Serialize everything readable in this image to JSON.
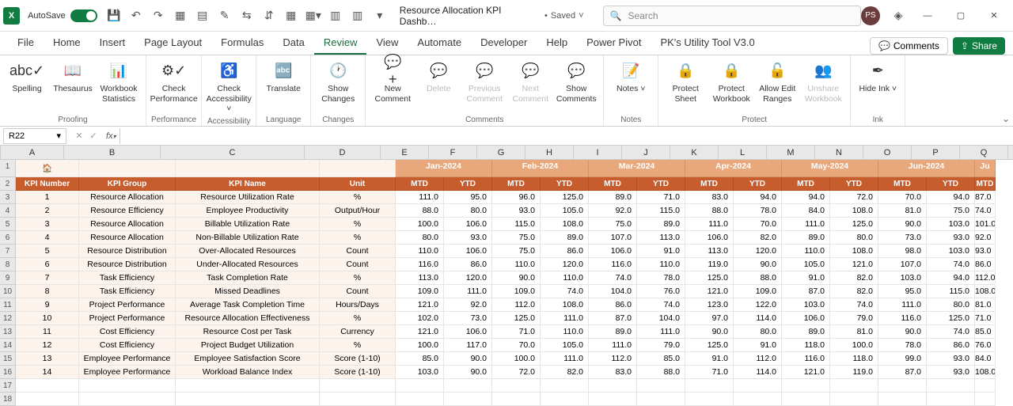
{
  "titlebar": {
    "autosave_label": "AutoSave",
    "doc_name": "Resource Allocation KPI Dashb…",
    "saved_label": "Saved",
    "search_placeholder": "Search",
    "avatar": "PS"
  },
  "menu": {
    "tabs": [
      "File",
      "Home",
      "Insert",
      "Page Layout",
      "Formulas",
      "Data",
      "Review",
      "View",
      "Automate",
      "Developer",
      "Help",
      "Power Pivot",
      "PK's Utility Tool V3.0"
    ],
    "active": "Review",
    "comments": "Comments",
    "share": "Share"
  },
  "ribbon": {
    "groups": [
      {
        "label": "Proofing",
        "items": [
          {
            "name": "spelling",
            "label": "Spelling",
            "icon": "abc✓"
          },
          {
            "name": "thesaurus",
            "label": "Thesaurus",
            "icon": "📖"
          },
          {
            "name": "workbook-stats",
            "label": "Workbook Statistics",
            "icon": "📊"
          }
        ]
      },
      {
        "label": "Performance",
        "items": [
          {
            "name": "check-performance",
            "label": "Check Performance",
            "icon": "⚙✓"
          }
        ]
      },
      {
        "label": "Accessibility",
        "items": [
          {
            "name": "check-accessibility",
            "label": "Check Accessibility ˅",
            "icon": "♿"
          }
        ]
      },
      {
        "label": "Language",
        "items": [
          {
            "name": "translate",
            "label": "Translate",
            "icon": "🔤"
          }
        ]
      },
      {
        "label": "Changes",
        "items": [
          {
            "name": "show-changes",
            "label": "Show Changes",
            "icon": "🕐"
          }
        ]
      },
      {
        "label": "Comments",
        "items": [
          {
            "name": "new-comment",
            "label": "New Comment",
            "icon": "💬+"
          },
          {
            "name": "delete-comment",
            "label": "Delete",
            "icon": "💬",
            "disabled": true
          },
          {
            "name": "prev-comment",
            "label": "Previous Comment",
            "icon": "💬",
            "disabled": true
          },
          {
            "name": "next-comment",
            "label": "Next Comment",
            "icon": "💬",
            "disabled": true
          },
          {
            "name": "show-comments",
            "label": "Show Comments",
            "icon": "💬"
          }
        ]
      },
      {
        "label": "Notes",
        "items": [
          {
            "name": "notes",
            "label": "Notes ˅",
            "icon": "📝"
          }
        ]
      },
      {
        "label": "Protect",
        "items": [
          {
            "name": "protect-sheet",
            "label": "Protect Sheet",
            "icon": "🔒"
          },
          {
            "name": "protect-workbook",
            "label": "Protect Workbook",
            "icon": "🔒"
          },
          {
            "name": "allow-edit-ranges",
            "label": "Allow Edit Ranges",
            "icon": "🔓"
          },
          {
            "name": "unshare-workbook",
            "label": "Unshare Workbook",
            "icon": "👥",
            "disabled": true
          }
        ]
      },
      {
        "label": "Ink",
        "items": [
          {
            "name": "hide-ink",
            "label": "Hide Ink ˅",
            "icon": "✒"
          }
        ]
      }
    ]
  },
  "formulabar": {
    "cell_ref": "R22"
  },
  "columns_letters": [
    "A",
    "B",
    "C",
    "D",
    "E",
    "F",
    "G",
    "H",
    "I",
    "J",
    "K",
    "L",
    "M",
    "N",
    "O",
    "P",
    "Q"
  ],
  "months": [
    "Jan-2024",
    "Feb-2024",
    "Mar-2024",
    "Apr-2024",
    "May-2024",
    "Jun-2024",
    "Ju"
  ],
  "header2_left": [
    "KPI Number",
    "KPI Group",
    "KPI Name",
    "Unit"
  ],
  "mtd": "MTD",
  "ytd": "YTD",
  "rows": [
    {
      "n": "1",
      "g": "Resource Allocation",
      "name": "Resource Utilization Rate",
      "unit": "%",
      "v": [
        "111.0",
        "95.0",
        "96.0",
        "125.0",
        "89.0",
        "71.0",
        "83.0",
        "94.0",
        "94.0",
        "72.0",
        "70.0",
        "94.0",
        "87.0"
      ]
    },
    {
      "n": "2",
      "g": "Resource Efficiency",
      "name": "Employee Productivity",
      "unit": "Output/Hour",
      "v": [
        "88.0",
        "80.0",
        "93.0",
        "105.0",
        "92.0",
        "115.0",
        "88.0",
        "78.0",
        "84.0",
        "108.0",
        "81.0",
        "75.0",
        "74.0"
      ]
    },
    {
      "n": "3",
      "g": "Resource Allocation",
      "name": "Billable Utilization Rate",
      "unit": "%",
      "v": [
        "100.0",
        "106.0",
        "115.0",
        "108.0",
        "75.0",
        "89.0",
        "111.0",
        "70.0",
        "111.0",
        "125.0",
        "90.0",
        "103.0",
        "101.0"
      ]
    },
    {
      "n": "4",
      "g": "Resource Allocation",
      "name": "Non-Billable Utilization Rate",
      "unit": "%",
      "v": [
        "80.0",
        "93.0",
        "75.0",
        "89.0",
        "107.0",
        "113.0",
        "106.0",
        "82.0",
        "89.0",
        "80.0",
        "73.0",
        "93.0",
        "92.0"
      ]
    },
    {
      "n": "5",
      "g": "Resource Distribution",
      "name": "Over-Allocated Resources",
      "unit": "Count",
      "v": [
        "110.0",
        "106.0",
        "75.0",
        "86.0",
        "106.0",
        "91.0",
        "113.0",
        "120.0",
        "110.0",
        "108.0",
        "98.0",
        "103.0",
        "93.0"
      ]
    },
    {
      "n": "6",
      "g": "Resource Distribution",
      "name": "Under-Allocated Resources",
      "unit": "Count",
      "v": [
        "116.0",
        "86.0",
        "110.0",
        "120.0",
        "116.0",
        "110.0",
        "119.0",
        "90.0",
        "105.0",
        "121.0",
        "107.0",
        "74.0",
        "86.0"
      ]
    },
    {
      "n": "7",
      "g": "Task Efficiency",
      "name": "Task Completion Rate",
      "unit": "%",
      "v": [
        "113.0",
        "120.0",
        "90.0",
        "110.0",
        "74.0",
        "78.0",
        "125.0",
        "88.0",
        "91.0",
        "82.0",
        "103.0",
        "94.0",
        "112.0"
      ]
    },
    {
      "n": "8",
      "g": "Task Efficiency",
      "name": "Missed Deadlines",
      "unit": "Count",
      "v": [
        "109.0",
        "111.0",
        "109.0",
        "74.0",
        "104.0",
        "76.0",
        "121.0",
        "109.0",
        "87.0",
        "82.0",
        "95.0",
        "115.0",
        "108.0"
      ]
    },
    {
      "n": "9",
      "g": "Project Performance",
      "name": "Average Task Completion Time",
      "unit": "Hours/Days",
      "v": [
        "121.0",
        "92.0",
        "112.0",
        "108.0",
        "86.0",
        "74.0",
        "123.0",
        "122.0",
        "103.0",
        "74.0",
        "111.0",
        "80.0",
        "81.0"
      ]
    },
    {
      "n": "10",
      "g": "Project Performance",
      "name": "Resource Allocation Effectiveness",
      "unit": "%",
      "v": [
        "102.0",
        "73.0",
        "125.0",
        "111.0",
        "87.0",
        "104.0",
        "97.0",
        "114.0",
        "106.0",
        "79.0",
        "116.0",
        "125.0",
        "71.0"
      ]
    },
    {
      "n": "11",
      "g": "Cost Efficiency",
      "name": "Resource Cost per Task",
      "unit": "Currency",
      "v": [
        "121.0",
        "106.0",
        "71.0",
        "110.0",
        "89.0",
        "111.0",
        "90.0",
        "80.0",
        "89.0",
        "81.0",
        "90.0",
        "74.0",
        "85.0"
      ]
    },
    {
      "n": "12",
      "g": "Cost Efficiency",
      "name": "Project Budget Utilization",
      "unit": "%",
      "v": [
        "100.0",
        "117.0",
        "70.0",
        "105.0",
        "111.0",
        "79.0",
        "125.0",
        "91.0",
        "118.0",
        "100.0",
        "78.0",
        "86.0",
        "76.0"
      ]
    },
    {
      "n": "13",
      "g": "Employee Performance",
      "name": "Employee Satisfaction Score",
      "unit": "Score (1-10)",
      "v": [
        "85.0",
        "90.0",
        "100.0",
        "111.0",
        "112.0",
        "85.0",
        "91.0",
        "112.0",
        "116.0",
        "118.0",
        "99.0",
        "93.0",
        "84.0"
      ]
    },
    {
      "n": "14",
      "g": "Employee Performance",
      "name": "Workload Balance Index",
      "unit": "Score (1-10)",
      "v": [
        "103.0",
        "90.0",
        "72.0",
        "82.0",
        "83.0",
        "88.0",
        "71.0",
        "114.0",
        "121.0",
        "119.0",
        "87.0",
        "93.0",
        "108.0"
      ]
    }
  ]
}
